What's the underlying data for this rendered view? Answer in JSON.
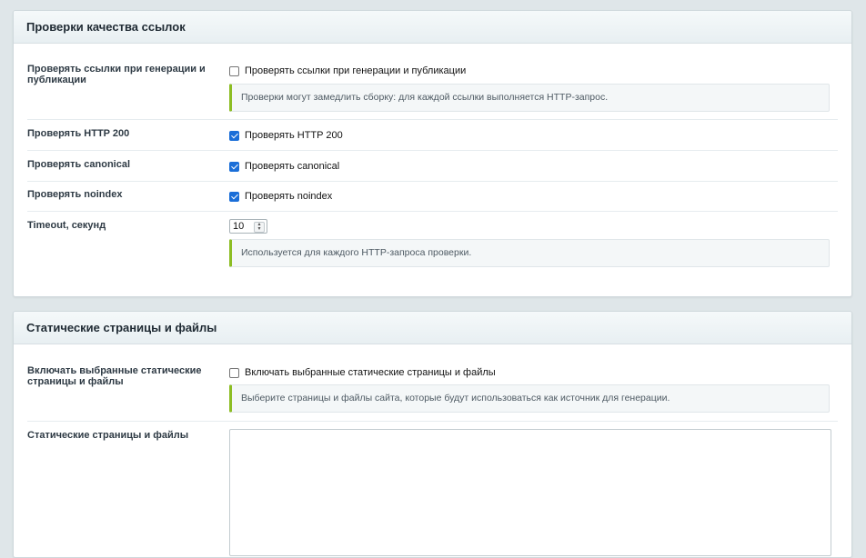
{
  "section1": {
    "title": "Проверки качества ссылок",
    "rows": {
      "check_links": {
        "label": "Проверять ссылки при генерации и публикации",
        "checkbox_label": "Проверять ссылки при генерации и публикации",
        "checked": false,
        "hint": "Проверки могут замедлить сборку: для каждой ссылки выполняется HTTP-запрос."
      },
      "http200": {
        "label": "Проверять HTTP 200",
        "checkbox_label": "Проверять HTTP 200",
        "checked": true
      },
      "canonical": {
        "label": "Проверять canonical",
        "checkbox_label": "Проверять canonical",
        "checked": true
      },
      "noindex": {
        "label": "Проверять noindex",
        "checkbox_label": "Проверять noindex",
        "checked": true
      },
      "timeout": {
        "label": "Timeout, секунд",
        "value": "10",
        "hint": "Используется для каждого HTTP-запроса проверки."
      }
    }
  },
  "section2": {
    "title": "Статические страницы и файлы",
    "rows": {
      "include_static": {
        "label": "Включать выбранные статические страницы и файлы",
        "checkbox_label": "Включать выбранные статические страницы и файлы",
        "checked": false,
        "hint": "Выберите страницы и файлы сайта, которые будут использоваться как источник для генерации."
      },
      "static_list": {
        "label": "Статические страницы и файлы",
        "value": ""
      }
    }
  },
  "colors": {
    "background": "#dfe6e9",
    "hint_accent": "#8cbd23",
    "checkbox_checked": "#1a6ed8"
  }
}
